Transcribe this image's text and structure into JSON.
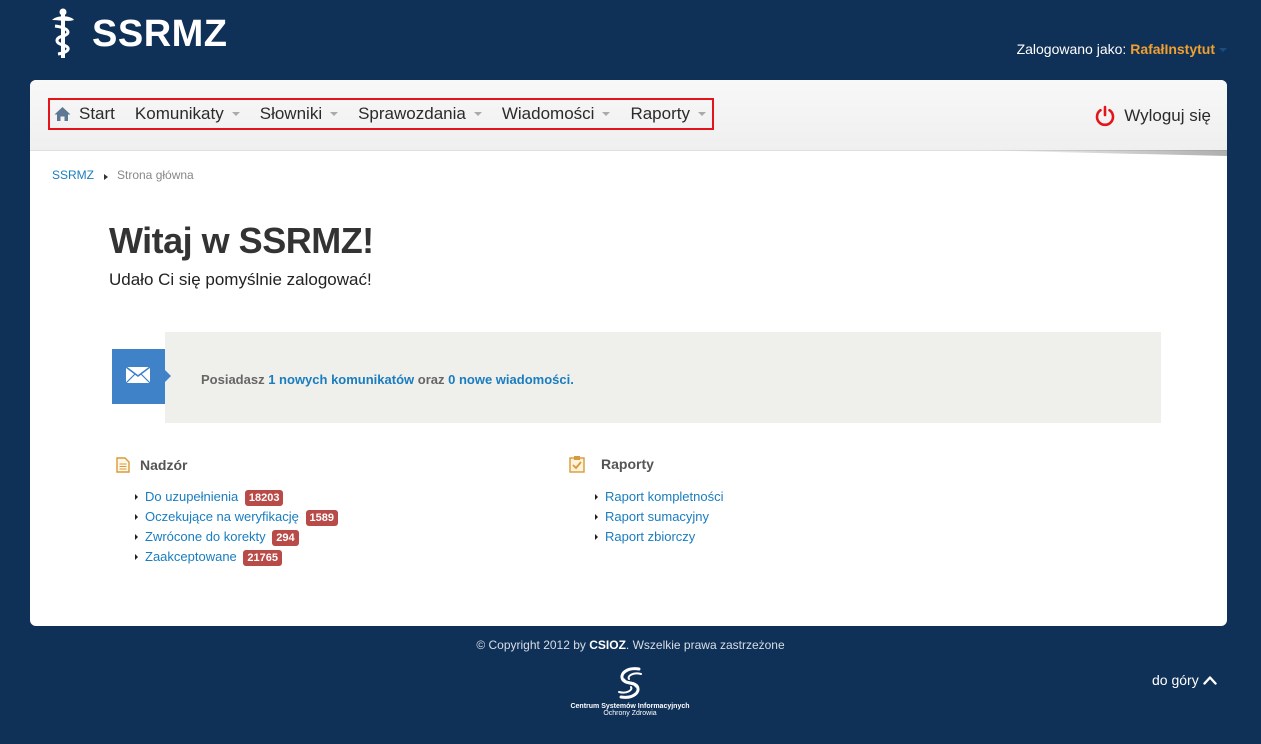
{
  "header": {
    "logo_text": "SSRMZ",
    "user_prefix": "Zalogowano jako:",
    "user_name": "RafałInstytut"
  },
  "nav": {
    "items": [
      {
        "label": "Start"
      },
      {
        "label": "Komunikaty"
      },
      {
        "label": "Słowniki"
      },
      {
        "label": "Sprawozdania"
      },
      {
        "label": "Wiadomości"
      },
      {
        "label": "Raporty"
      }
    ],
    "logout_label": "Wyloguj się"
  },
  "breadcrumb": {
    "root": "SSRMZ",
    "current": "Strona główna"
  },
  "welcome": {
    "title": "Witaj w SSRMZ!",
    "subtitle": "Udało Ci się pomyślnie zalogować!"
  },
  "messages": {
    "prefix": "Posiadasz",
    "link1": "1 nowych komunikatów",
    "middle": "oraz",
    "link2": "0 nowe wiadomości."
  },
  "nadzor": {
    "heading": "Nadzór",
    "items": [
      {
        "label": "Do uzupełnienia",
        "count": "18203"
      },
      {
        "label": "Oczekujące na weryfikację",
        "count": "1589"
      },
      {
        "label": "Zwrócone do korekty",
        "count": "294"
      },
      {
        "label": "Zaakceptowane",
        "count": "21765"
      }
    ]
  },
  "raporty": {
    "heading": "Raporty",
    "items": [
      {
        "label": "Raport kompletności"
      },
      {
        "label": "Raport sumacyjny"
      },
      {
        "label": "Raport zbiorczy"
      }
    ]
  },
  "footer": {
    "copyright_prefix": "© Copyright 2012 by",
    "copyright_brand": "CSIOZ",
    "copyright_suffix": ". Wszelkie prawa zastrzeżone",
    "logo_line1": "Centrum Systemów Informacyjnych",
    "logo_line2": "Ochrony Zdrowia",
    "to_top": "do góry"
  },
  "colors": {
    "background": "#0f3057",
    "accent": "#1a7dbf",
    "user_name": "#f0a030",
    "badge": "#b84a47",
    "nav_highlight": "#e3151a",
    "message_icon": "#3f82c7"
  }
}
